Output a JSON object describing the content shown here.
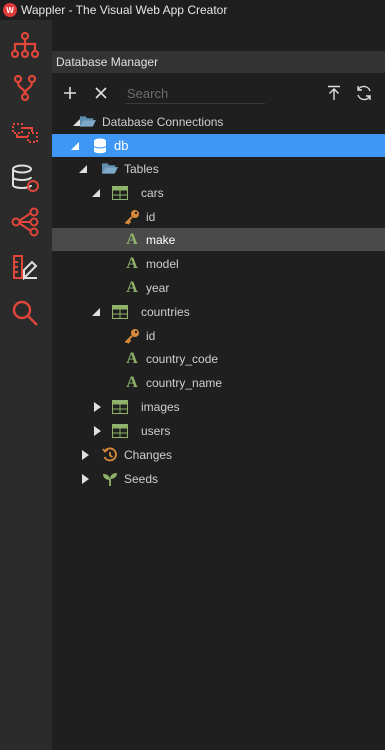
{
  "app": {
    "title": "Wappler - The Visual Web App Creator",
    "logo_text": "W"
  },
  "sidebar_icons": [
    {
      "name": "app-structure-icon"
    },
    {
      "name": "git-branch-icon"
    },
    {
      "name": "workflow-icon"
    },
    {
      "name": "database-manager-icon"
    },
    {
      "name": "share-icon"
    },
    {
      "name": "design-tools-icon"
    },
    {
      "name": "search-icon"
    }
  ],
  "panel": {
    "title": "Database Manager",
    "search_placeholder": "Search"
  },
  "tree": {
    "root": "Database Connections",
    "db": "db",
    "tables": "Tables",
    "cars": "cars",
    "cars_fields": [
      "id",
      "make",
      "model",
      "year"
    ],
    "countries": "countries",
    "countries_fields": [
      "id",
      "country_code",
      "country_name"
    ],
    "images": "images",
    "users": "users",
    "changes": "Changes",
    "seeds": "Seeds"
  },
  "colors": {
    "accent": "#3f97f5",
    "icon_red": "#e0463a",
    "table_green": "#8fb36a",
    "key_orange": "#d98a3a"
  }
}
